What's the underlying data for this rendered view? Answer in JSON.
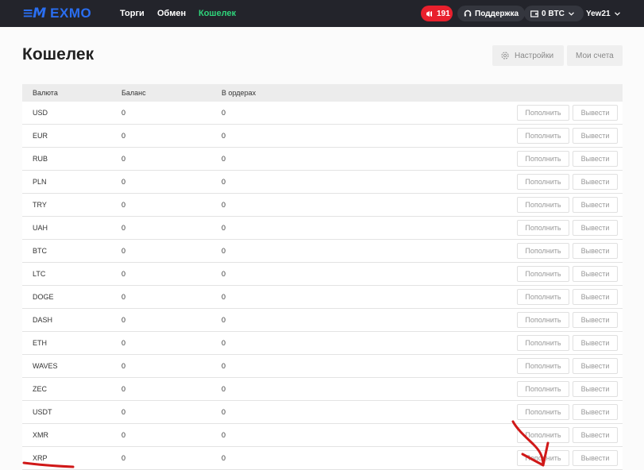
{
  "brand": {
    "name": "EXMO",
    "color": "#2a6ef0"
  },
  "nav": [
    {
      "label": "Торги"
    },
    {
      "label": "Обмен"
    },
    {
      "label": "Кошелек",
      "active": true,
      "color": "#2fd47b"
    }
  ],
  "header_right": {
    "notifications": {
      "count": "191",
      "color": "#e8202d",
      "icon": "megaphone-icon"
    },
    "support": {
      "label": "Поддержка",
      "icon": "headset-icon"
    },
    "balance": {
      "label": "0 BTC",
      "icon": "wallet-icon"
    },
    "user": {
      "label": "Yew21"
    }
  },
  "page": {
    "title": "Кошелек",
    "settings_label": "Настройки",
    "accounts_label": "Мои счета"
  },
  "table": {
    "headers": [
      "Валюта",
      "Баланс",
      "В ордерах"
    ],
    "deposit_label": "Пополнить",
    "withdraw_label": "Вывести",
    "rows": [
      {
        "currency": "USD",
        "balance": "0",
        "orders": "0"
      },
      {
        "currency": "EUR",
        "balance": "0",
        "orders": "0"
      },
      {
        "currency": "RUB",
        "balance": "0",
        "orders": "0"
      },
      {
        "currency": "PLN",
        "balance": "0",
        "orders": "0"
      },
      {
        "currency": "TRY",
        "balance": "0",
        "orders": "0"
      },
      {
        "currency": "UAH",
        "balance": "0",
        "orders": "0"
      },
      {
        "currency": "BTC",
        "balance": "0",
        "orders": "0"
      },
      {
        "currency": "LTC",
        "balance": "0",
        "orders": "0"
      },
      {
        "currency": "DOGE",
        "balance": "0",
        "orders": "0"
      },
      {
        "currency": "DASH",
        "balance": "0",
        "orders": "0"
      },
      {
        "currency": "ETH",
        "balance": "0",
        "orders": "0"
      },
      {
        "currency": "WAVES",
        "balance": "0",
        "orders": "0"
      },
      {
        "currency": "ZEC",
        "balance": "0",
        "orders": "0"
      },
      {
        "currency": "USDT",
        "balance": "0",
        "orders": "0"
      },
      {
        "currency": "XMR",
        "balance": "0",
        "orders": "0"
      },
      {
        "currency": "XRP",
        "balance": "0",
        "orders": "0"
      }
    ]
  },
  "annotation_color": "#d01818"
}
